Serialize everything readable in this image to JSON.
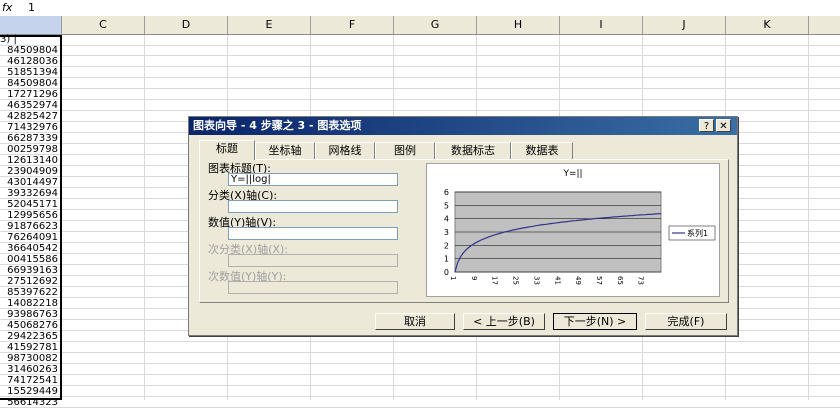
{
  "formula_bar": {
    "fx_label": "fx",
    "value": "1"
  },
  "columns": [
    "C",
    "D",
    "E",
    "F",
    "G",
    "H",
    "I",
    "J",
    "K"
  ],
  "column_a_header": "3) |",
  "column_a_values": [
    "84509804",
    "46128036",
    "51851394",
    "84509804",
    "17271296",
    "46352974",
    "42825427",
    "71432976",
    "66287339",
    "00259798",
    "12613140",
    "23904909",
    "43014497",
    "39332694",
    "52045171",
    "12995656",
    "91876623",
    "76264091",
    "36640542",
    "00415586",
    "66939163",
    "27512692",
    "85397622",
    "14082218",
    "93986763",
    "45068276",
    "29422365",
    "41592781",
    "98730082",
    "31460263",
    "74172541",
    "15529449",
    "56614323"
  ],
  "dialog": {
    "title": "图表向导 - 4 步骤之 3 - 图表选项",
    "help_button": "?",
    "close_button": "✕",
    "tabs": [
      "标题",
      "坐标轴",
      "网格线",
      "图例",
      "数据标志",
      "数据表"
    ],
    "fields": {
      "chart_title_label": "图表标题(T):",
      "chart_title_value": "Y=||log|",
      "category_x_label": "分类(X)轴(C):",
      "value_y_label": "数值(Y)轴(V):",
      "secondary_category_label": "次分类(X)轴(X):",
      "secondary_value_label": "次数值(Y)轴(Y):"
    },
    "buttons": {
      "cancel": "取消",
      "back": "< 上一步(B)",
      "next": "下一步(N) >",
      "finish": "完成(F)"
    }
  },
  "chart_data": {
    "type": "line",
    "title": "Y=||",
    "x": [
      1,
      2,
      3,
      4,
      5,
      6,
      7,
      8,
      9,
      10,
      11,
      12,
      13,
      14,
      15,
      16,
      17,
      18,
      19,
      20,
      21,
      22,
      23,
      24,
      25,
      26,
      27,
      28,
      29,
      30,
      31,
      32,
      33,
      34,
      35,
      36,
      37,
      38,
      39,
      40,
      41,
      42,
      43,
      44,
      45,
      46,
      47,
      48,
      49,
      50,
      51,
      52,
      53,
      54,
      55,
      56,
      57,
      58,
      59,
      60,
      61,
      62,
      63,
      64,
      65,
      66,
      67,
      68,
      69,
      70,
      71,
      72,
      73,
      74,
      75,
      76,
      77,
      78,
      79,
      80
    ],
    "x_tick_labels": [
      "1",
      "9",
      "17",
      "25",
      "33",
      "41",
      "49",
      "57",
      "65",
      "73"
    ],
    "series": [
      {
        "name": "系列1",
        "color": "#33338a",
        "values": [
          0.0,
          0.69,
          1.1,
          1.39,
          1.61,
          1.79,
          1.95,
          2.08,
          2.2,
          2.3,
          2.4,
          2.48,
          2.56,
          2.64,
          2.71,
          2.77,
          2.83,
          2.89,
          2.94,
          3.0,
          3.04,
          3.09,
          3.14,
          3.18,
          3.22,
          3.26,
          3.3,
          3.33,
          3.37,
          3.4,
          3.43,
          3.47,
          3.5,
          3.53,
          3.56,
          3.58,
          3.61,
          3.64,
          3.66,
          3.69,
          3.71,
          3.74,
          3.76,
          3.78,
          3.81,
          3.83,
          3.85,
          3.87,
          3.89,
          3.91,
          3.93,
          3.95,
          3.97,
          3.99,
          4.01,
          4.03,
          4.04,
          4.06,
          4.08,
          4.09,
          4.11,
          4.13,
          4.14,
          4.16,
          4.17,
          4.19,
          4.2,
          4.22,
          4.23,
          4.25,
          4.26,
          4.28,
          4.29,
          4.3,
          4.32,
          4.33,
          4.34,
          4.36,
          4.37,
          4.38
        ]
      }
    ],
    "ylim": [
      0,
      6
    ],
    "y_ticks": [
      0,
      1,
      2,
      3,
      4,
      5,
      6
    ],
    "grid": true,
    "plot_background": "#c0c0c0",
    "legend": "right"
  }
}
